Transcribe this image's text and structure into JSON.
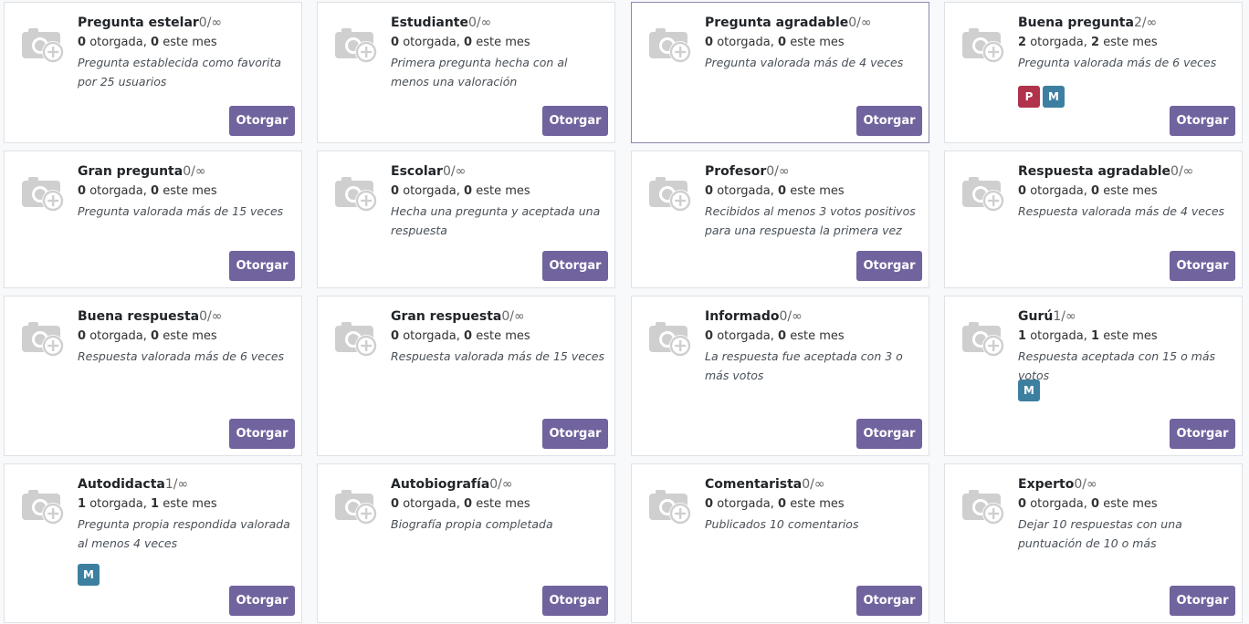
{
  "button_label": "Otorgar",
  "awarded_word": "otorgada,",
  "month_word": "este mes",
  "colors": {
    "button": "#71639e",
    "avatar_p": "#b0334b",
    "avatar_m": "#3d7fa0"
  },
  "icon": "camera-add-icon",
  "badges": [
    {
      "name": "Pregunta estelar",
      "limit": "0/∞",
      "awarded": "0",
      "month": "0",
      "desc": "Pregunta establecida como favorita por 25 usuarios",
      "avatars": []
    },
    {
      "name": "Estudiante",
      "limit": "0/∞",
      "awarded": "0",
      "month": "0",
      "desc": "Primera pregunta hecha con al menos una valoración",
      "avatars": []
    },
    {
      "name": "Pregunta agradable",
      "limit": "0/∞",
      "awarded": "0",
      "month": "0",
      "desc": "Pregunta valorada más de 4 veces",
      "avatars": []
    },
    {
      "name": "Buena pregunta",
      "limit": "2/∞",
      "awarded": "2",
      "month": "2",
      "desc": "Pregunta valorada más de 6 veces",
      "avatars": [
        "P",
        "M"
      ]
    },
    {
      "name": "Gran pregunta",
      "limit": "0/∞",
      "awarded": "0",
      "month": "0",
      "desc": "Pregunta valorada más de 15 veces",
      "avatars": []
    },
    {
      "name": "Escolar",
      "limit": "0/∞",
      "awarded": "0",
      "month": "0",
      "desc": "Hecha una pregunta y aceptada una respuesta",
      "avatars": []
    },
    {
      "name": "Profesor",
      "limit": "0/∞",
      "awarded": "0",
      "month": "0",
      "desc": "Recibidos al menos 3 votos positivos para una respuesta la primera vez",
      "avatars": []
    },
    {
      "name": "Respuesta agradable",
      "limit": "0/∞",
      "awarded": "0",
      "month": "0",
      "desc": "Respuesta valorada más de 4 veces",
      "avatars": []
    },
    {
      "name": "Buena respuesta",
      "limit": "0/∞",
      "awarded": "0",
      "month": "0",
      "desc": "Respuesta valorada más de 6 veces",
      "avatars": []
    },
    {
      "name": "Gran respuesta",
      "limit": "0/∞",
      "awarded": "0",
      "month": "0",
      "desc": "Respuesta valorada más de 15 veces",
      "avatars": []
    },
    {
      "name": "Informado",
      "limit": "0/∞",
      "awarded": "0",
      "month": "0",
      "desc": "La respuesta fue aceptada con 3 o más votos",
      "avatars": []
    },
    {
      "name": "Gurú",
      "limit": "1/∞",
      "awarded": "1",
      "month": "1",
      "desc": "Respuesta aceptada con 15 o más votos",
      "avatars": [
        "M"
      ]
    },
    {
      "name": "Autodidacta",
      "limit": "1/∞",
      "awarded": "1",
      "month": "1",
      "desc": "Pregunta propia respondida valorada al menos 4 veces",
      "avatars": [
        "M"
      ]
    },
    {
      "name": "Autobiografía",
      "limit": "0/∞",
      "awarded": "0",
      "month": "0",
      "desc": "Biografía propia completada",
      "avatars": []
    },
    {
      "name": "Comentarista",
      "limit": "0/∞",
      "awarded": "0",
      "month": "0",
      "desc": "Publicados 10 comentarios",
      "avatars": []
    },
    {
      "name": "Experto",
      "limit": "0/∞",
      "awarded": "0",
      "month": "0",
      "desc": "Dejar 10 respuestas con una puntuación de 10 o más",
      "avatars": []
    }
  ]
}
